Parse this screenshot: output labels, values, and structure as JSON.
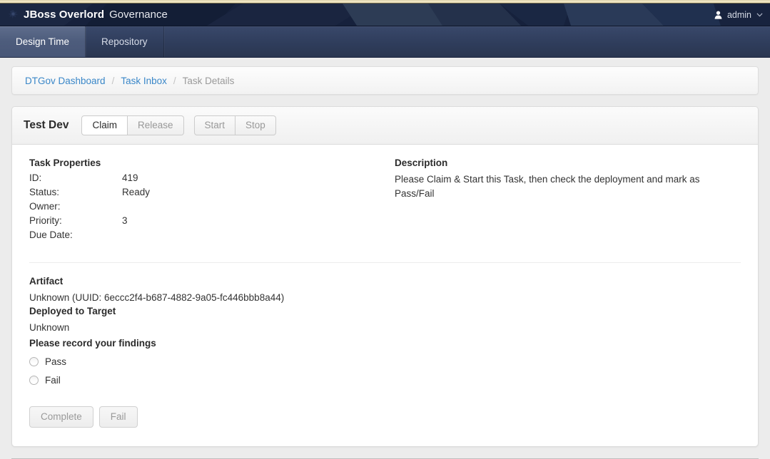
{
  "header": {
    "logo_icon": "jboss-bird-icon",
    "brand": "JBoss Overlord",
    "product": "Governance",
    "user_icon": "user-icon",
    "user_name": "admin",
    "caret_icon": "chevron-down-icon"
  },
  "nav": {
    "tabs": [
      {
        "label": "Design Time",
        "active": true
      },
      {
        "label": "Repository",
        "active": false
      }
    ]
  },
  "breadcrumb": {
    "separator": "/",
    "items": [
      {
        "label": "DTGov Dashboard",
        "current": false
      },
      {
        "label": "Task Inbox",
        "current": false
      },
      {
        "label": "Task Details",
        "current": true
      }
    ]
  },
  "panel": {
    "title": "Test Dev",
    "actions": [
      {
        "label": "Claim",
        "enabled": true
      },
      {
        "label": "Release",
        "enabled": false
      },
      {
        "label": "Start",
        "enabled": false
      },
      {
        "label": "Stop",
        "enabled": false
      }
    ]
  },
  "task_properties": {
    "heading": "Task Properties",
    "rows": [
      {
        "label": "ID:",
        "value": "419"
      },
      {
        "label": "Status:",
        "value": "Ready"
      },
      {
        "label": "Owner:",
        "value": ""
      },
      {
        "label": "Priority:",
        "value": "3"
      },
      {
        "label": "Due Date:",
        "value": ""
      }
    ]
  },
  "description": {
    "heading": "Description",
    "text": "Please Claim & Start this Task, then check the deployment and mark as Pass/Fail"
  },
  "artifact": {
    "heading": "Artifact",
    "value": "Unknown (UUID: 6eccc2f4-b687-4882-9a05-fc446bbb8a44)",
    "target_heading": "Deployed to Target",
    "target_value": "Unknown"
  },
  "findings": {
    "heading": "Please record your findings",
    "options": [
      {
        "label": "Pass",
        "selected": false
      },
      {
        "label": "Fail",
        "selected": false
      }
    ]
  },
  "footer": {
    "buttons": [
      {
        "label": "Complete",
        "enabled": false
      },
      {
        "label": "Fail",
        "enabled": false
      }
    ]
  },
  "colors": {
    "accent_stripe": "#f3e9c8",
    "header_bg": "#16213c",
    "nav_bg": "#2f3d5c",
    "nav_active": "#4e5d7d",
    "link": "#3a87c8",
    "page_bg": "#ececec"
  }
}
